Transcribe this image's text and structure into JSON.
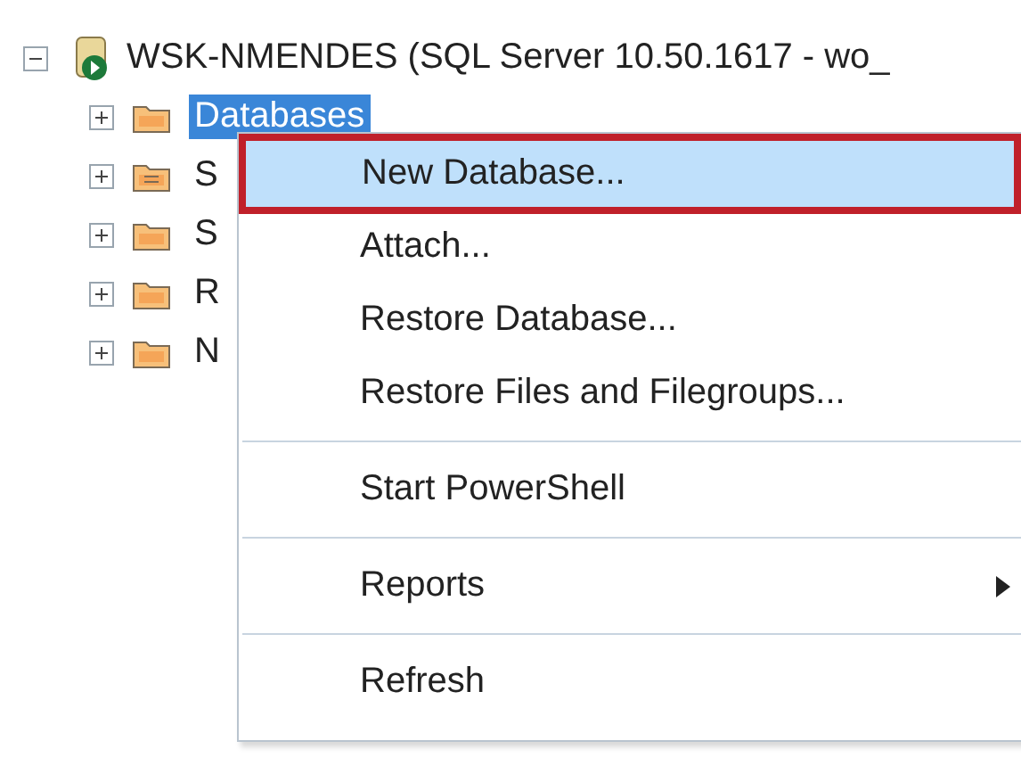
{
  "tree": {
    "label": "WSK-NMENDES (SQL Server 10.50.1617 - wo_",
    "expanded": true,
    "children": [
      {
        "label": "Databases",
        "kind": "folder",
        "expanded": false,
        "selected": true
      },
      {
        "label": "S",
        "kind": "special-folder",
        "expanded": false,
        "selected": false
      },
      {
        "label": "S",
        "kind": "folder",
        "expanded": false,
        "selected": false
      },
      {
        "label": "R",
        "kind": "folder",
        "expanded": false,
        "selected": false
      },
      {
        "label": "N",
        "kind": "folder",
        "expanded": false,
        "selected": false
      }
    ]
  },
  "context_menu": {
    "items": [
      {
        "kind": "item",
        "label": "New Database...",
        "selected": true,
        "outlined": true,
        "submenu": false
      },
      {
        "kind": "item",
        "label": "Attach...",
        "selected": false,
        "outlined": false,
        "submenu": false
      },
      {
        "kind": "item",
        "label": "Restore Database...",
        "selected": false,
        "outlined": false,
        "submenu": false
      },
      {
        "kind": "item",
        "label": "Restore Files and Filegroups...",
        "selected": false,
        "outlined": false,
        "submenu": false
      },
      {
        "kind": "separator"
      },
      {
        "kind": "item",
        "label": "Start PowerShell",
        "selected": false,
        "outlined": false,
        "submenu": false
      },
      {
        "kind": "separator"
      },
      {
        "kind": "item",
        "label": "Reports",
        "selected": false,
        "outlined": false,
        "submenu": true
      },
      {
        "kind": "separator"
      },
      {
        "kind": "item",
        "label": "Refresh",
        "selected": false,
        "outlined": false,
        "submenu": false
      }
    ]
  }
}
